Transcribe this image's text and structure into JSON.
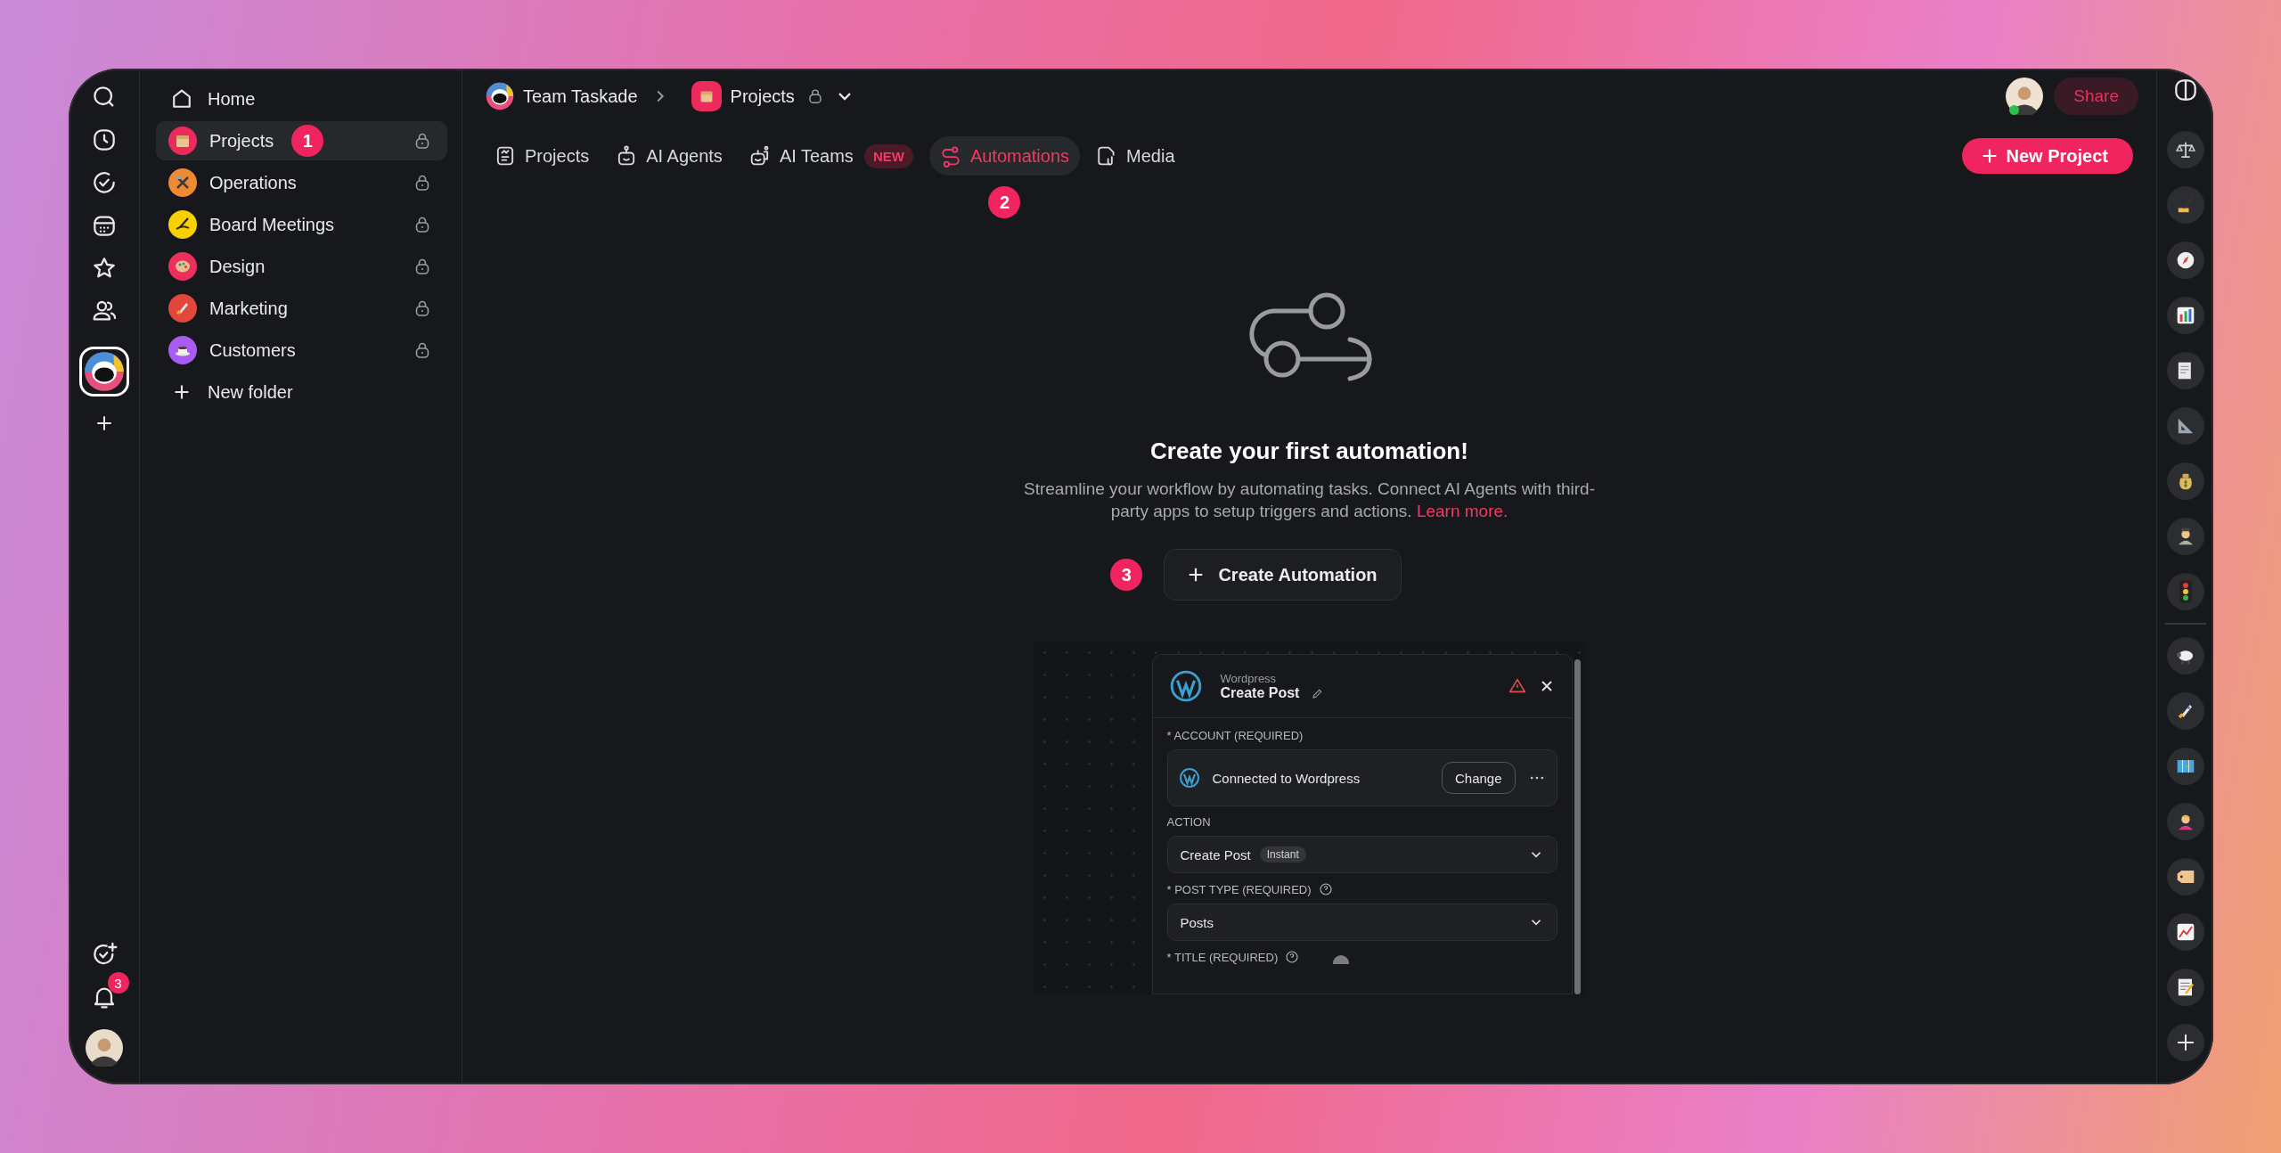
{
  "left_rail": {
    "notification_count": "3"
  },
  "sidebar": {
    "items": [
      {
        "label": "Home",
        "kind": "home",
        "selected": false,
        "locked": false
      },
      {
        "label": "Projects",
        "kind": "folder",
        "selected": true,
        "locked": true,
        "color": "#ec2a5c",
        "marker": "1"
      },
      {
        "label": "Operations",
        "kind": "folder",
        "selected": false,
        "locked": true,
        "color": "#f08a32"
      },
      {
        "label": "Board Meetings",
        "kind": "folder",
        "selected": false,
        "locked": true,
        "color": "#f6d000"
      },
      {
        "label": "Design",
        "kind": "folder",
        "selected": false,
        "locked": true,
        "color": "#ec2f5d"
      },
      {
        "label": "Marketing",
        "kind": "folder",
        "selected": false,
        "locked": true,
        "color": "#e1473a"
      },
      {
        "label": "Customers",
        "kind": "folder",
        "selected": false,
        "locked": true,
        "color": "#a85cf2"
      },
      {
        "label": "New folder",
        "kind": "add",
        "selected": false,
        "locked": false
      }
    ]
  },
  "breadcrumb": {
    "workspace": "Team Taskade",
    "project": "Projects"
  },
  "tabs": [
    {
      "label": "Projects",
      "selected": false
    },
    {
      "label": "AI Agents",
      "selected": false
    },
    {
      "label": "AI Teams",
      "selected": false,
      "badge": "NEW"
    },
    {
      "label": "Automations",
      "selected": true,
      "marker": "2"
    },
    {
      "label": "Media",
      "selected": false
    }
  ],
  "share_button": "Share",
  "new_project_button": "New Project",
  "empty_state": {
    "title": "Create your first automation!",
    "description": "Streamline your workflow by automating tasks. Connect AI Agents with third-party apps to setup triggers and actions.",
    "link": "Learn more.",
    "button": "Create Automation",
    "marker": "3"
  },
  "preview": {
    "service": "Wordpress",
    "title": "Create Post",
    "fields": [
      {
        "kind": "account",
        "label": "* ACCOUNT (REQUIRED)",
        "value": "Connected to Wordpress",
        "button": "Change"
      },
      {
        "kind": "select",
        "label": "ACTION",
        "value": "Create Post",
        "tag": "Instant"
      },
      {
        "kind": "select",
        "label": "* POST TYPE (REQUIRED)",
        "help": true,
        "value": "Posts"
      },
      {
        "kind": "label",
        "label": "* TITLE (REQUIRED)",
        "help": true
      }
    ]
  }
}
